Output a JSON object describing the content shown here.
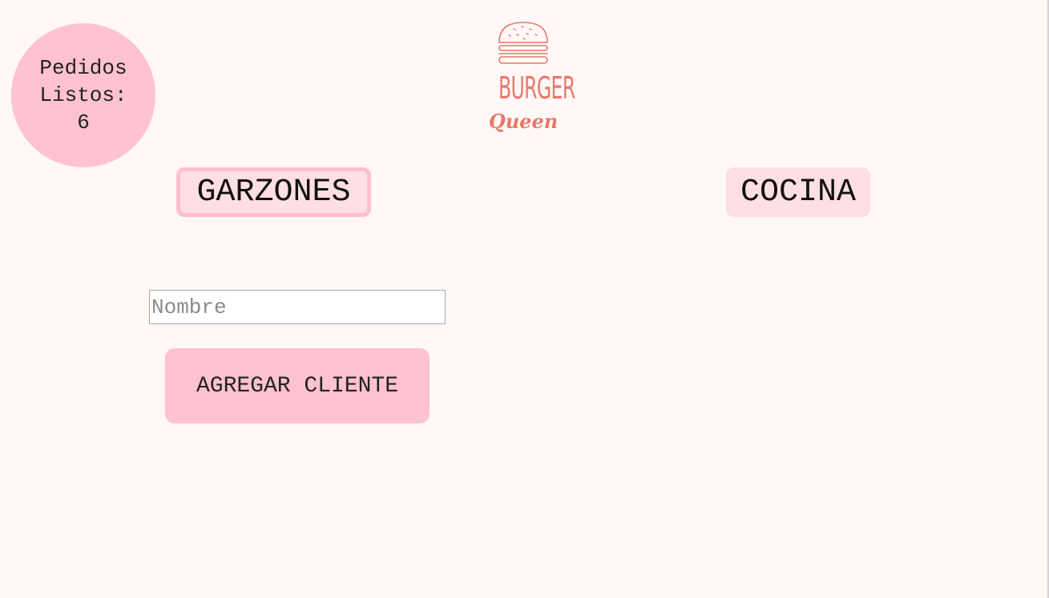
{
  "ready_orders": {
    "line1": "Pedidos",
    "line2": "Listos:",
    "count": "6"
  },
  "logo": {
    "word1": "BURGER",
    "word2": "Queen",
    "icon": "burger-icon"
  },
  "tabs": {
    "waiters": "GARZONES",
    "kitchen": "COCINA"
  },
  "form": {
    "name_placeholder": "Nombre",
    "name_value": "",
    "add_button": "AGREGAR CLIENTE"
  },
  "colors": {
    "background": "#fff8f7",
    "accent_pink": "#ffc2d1",
    "tab_pink": "#ffdfe3",
    "logo_coral": "#e8786a"
  }
}
